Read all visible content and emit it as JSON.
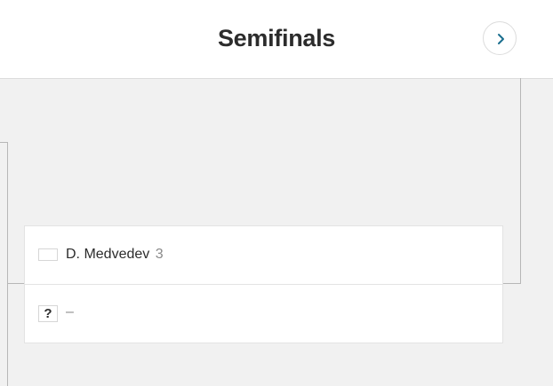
{
  "header": {
    "title": "Semifinals"
  },
  "navigation": {
    "next_icon": "chevron-right-icon",
    "accent_color": "#1a6e8e"
  },
  "match": {
    "player1": {
      "name": "D. Medvedev",
      "seed": "3",
      "flag_icon": "flag-icon"
    },
    "player2": {
      "placeholder_symbol": "?",
      "name": "–"
    }
  }
}
